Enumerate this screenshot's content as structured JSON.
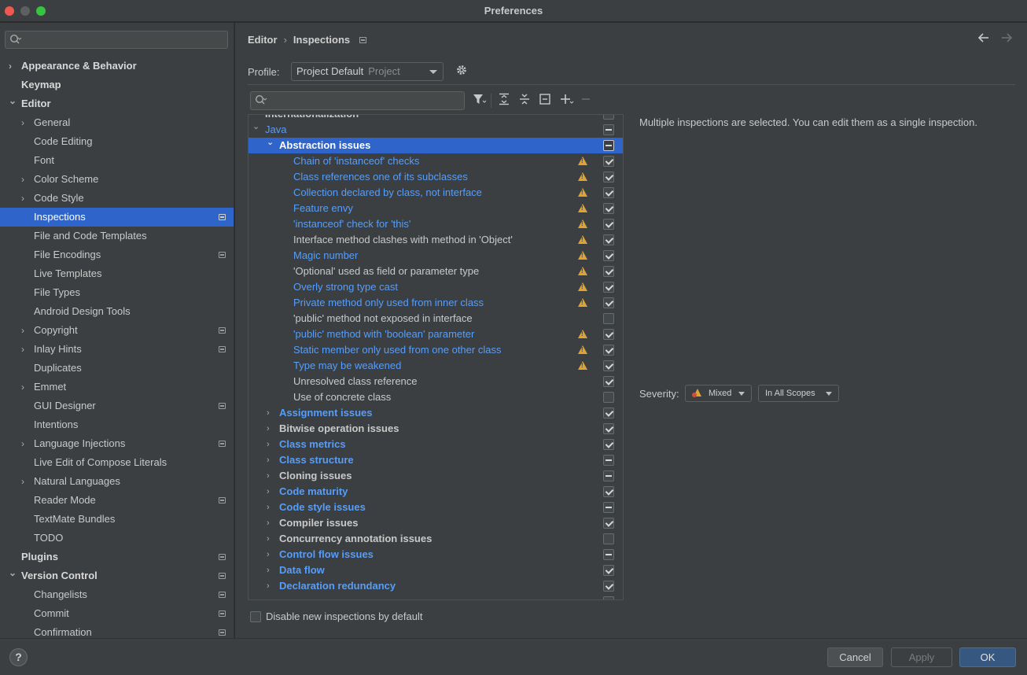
{
  "window": {
    "title": "Preferences"
  },
  "sidebar": {
    "search_placeholder": "",
    "items": [
      {
        "label": "Appearance & Behavior",
        "level": 0,
        "bold": true,
        "expandable": true,
        "expanded": false,
        "project": false,
        "selected": false
      },
      {
        "label": "Keymap",
        "level": 0,
        "bold": true,
        "expandable": false,
        "project": false,
        "selected": false
      },
      {
        "label": "Editor",
        "level": 0,
        "bold": true,
        "expandable": true,
        "expanded": true,
        "project": false,
        "selected": false
      },
      {
        "label": "General",
        "level": 1,
        "expandable": true,
        "expanded": false,
        "project": false,
        "selected": false
      },
      {
        "label": "Code Editing",
        "level": 1,
        "expandable": false,
        "project": false,
        "selected": false
      },
      {
        "label": "Font",
        "level": 1,
        "expandable": false,
        "project": false,
        "selected": false
      },
      {
        "label": "Color Scheme",
        "level": 1,
        "expandable": true,
        "expanded": false,
        "project": false,
        "selected": false
      },
      {
        "label": "Code Style",
        "level": 1,
        "expandable": true,
        "expanded": false,
        "project": false,
        "selected": false
      },
      {
        "label": "Inspections",
        "level": 1,
        "expandable": false,
        "project": true,
        "selected": true
      },
      {
        "label": "File and Code Templates",
        "level": 1,
        "expandable": false,
        "project": false,
        "selected": false
      },
      {
        "label": "File Encodings",
        "level": 1,
        "expandable": false,
        "project": true,
        "selected": false
      },
      {
        "label": "Live Templates",
        "level": 1,
        "expandable": false,
        "project": false,
        "selected": false
      },
      {
        "label": "File Types",
        "level": 1,
        "expandable": false,
        "project": false,
        "selected": false
      },
      {
        "label": "Android Design Tools",
        "level": 1,
        "expandable": false,
        "project": false,
        "selected": false
      },
      {
        "label": "Copyright",
        "level": 1,
        "expandable": true,
        "expanded": false,
        "project": true,
        "selected": false
      },
      {
        "label": "Inlay Hints",
        "level": 1,
        "expandable": true,
        "expanded": false,
        "project": true,
        "selected": false
      },
      {
        "label": "Duplicates",
        "level": 1,
        "expandable": false,
        "project": false,
        "selected": false
      },
      {
        "label": "Emmet",
        "level": 1,
        "expandable": true,
        "expanded": false,
        "project": false,
        "selected": false
      },
      {
        "label": "GUI Designer",
        "level": 1,
        "expandable": false,
        "project": true,
        "selected": false
      },
      {
        "label": "Intentions",
        "level": 1,
        "expandable": false,
        "project": false,
        "selected": false
      },
      {
        "label": "Language Injections",
        "level": 1,
        "expandable": true,
        "expanded": false,
        "project": true,
        "selected": false
      },
      {
        "label": "Live Edit of Compose Literals",
        "level": 1,
        "expandable": false,
        "project": false,
        "selected": false
      },
      {
        "label": "Natural Languages",
        "level": 1,
        "expandable": true,
        "expanded": false,
        "project": false,
        "selected": false
      },
      {
        "label": "Reader Mode",
        "level": 1,
        "expandable": false,
        "project": true,
        "selected": false
      },
      {
        "label": "TextMate Bundles",
        "level": 1,
        "expandable": false,
        "project": false,
        "selected": false
      },
      {
        "label": "TODO",
        "level": 1,
        "expandable": false,
        "project": false,
        "selected": false
      },
      {
        "label": "Plugins",
        "level": 0,
        "bold": true,
        "expandable": false,
        "project": true,
        "selected": false
      },
      {
        "label": "Version Control",
        "level": 0,
        "bold": true,
        "expandable": true,
        "expanded": true,
        "project": true,
        "selected": false
      },
      {
        "label": "Changelists",
        "level": 1,
        "expandable": false,
        "project": true,
        "selected": false
      },
      {
        "label": "Commit",
        "level": 1,
        "expandable": false,
        "project": true,
        "selected": false
      },
      {
        "label": "Confirmation",
        "level": 1,
        "expandable": false,
        "project": true,
        "selected": false
      }
    ]
  },
  "header": {
    "breadcrumb": [
      "Editor",
      "Inspections"
    ],
    "back_icon": "arrow-left-icon",
    "forward_icon": "arrow-right-icon"
  },
  "profile": {
    "label": "Profile:",
    "value": "Project Default",
    "sub": "Project",
    "settings_icon": "gear-icon"
  },
  "toolbar": {
    "search_placeholder": "",
    "icons": [
      "filter-icon",
      "expand-all-icon",
      "collapse-all-icon",
      "reset-icon",
      "add-icon",
      "remove-icon"
    ]
  },
  "inspection_tree": {
    "partial_top_label": "Internationalization",
    "rows": [
      {
        "label": "Java",
        "level": 0,
        "chevron": "down",
        "link": true,
        "bold": false,
        "warn": false,
        "check": "mixed",
        "selected": false
      },
      {
        "label": "Abstraction issues",
        "level": 1,
        "chevron": "down",
        "link": false,
        "bold": true,
        "warn": false,
        "check": "mixed",
        "selected": true
      },
      {
        "label": "Chain of 'instanceof' checks",
        "level": 2,
        "link": true,
        "warn": true,
        "check": "checked"
      },
      {
        "label": "Class references one of its subclasses",
        "level": 2,
        "link": true,
        "warn": true,
        "check": "checked"
      },
      {
        "label": "Collection declared by class, not interface",
        "level": 2,
        "link": true,
        "warn": true,
        "check": "checked"
      },
      {
        "label": "Feature envy",
        "level": 2,
        "link": true,
        "warn": true,
        "check": "checked"
      },
      {
        "label": "'instanceof' check for 'this'",
        "level": 2,
        "link": true,
        "warn": true,
        "check": "checked"
      },
      {
        "label": "Interface method clashes with method in 'Object'",
        "level": 2,
        "link": false,
        "warn": true,
        "check": "checked"
      },
      {
        "label": "Magic number",
        "level": 2,
        "link": true,
        "warn": true,
        "check": "checked"
      },
      {
        "label": "'Optional' used as field or parameter type",
        "level": 2,
        "link": false,
        "warn": true,
        "check": "checked"
      },
      {
        "label": "Overly strong type cast",
        "level": 2,
        "link": true,
        "warn": true,
        "check": "checked"
      },
      {
        "label": "Private method only used from inner class",
        "level": 2,
        "link": true,
        "warn": true,
        "check": "checked"
      },
      {
        "label": "'public' method not exposed in interface",
        "level": 2,
        "link": false,
        "warn": false,
        "check": "unchecked"
      },
      {
        "label": "'public' method with 'boolean' parameter",
        "level": 2,
        "link": true,
        "warn": true,
        "check": "checked"
      },
      {
        "label": "Static member only used from one other class",
        "level": 2,
        "link": true,
        "warn": true,
        "check": "checked"
      },
      {
        "label": "Type may be weakened",
        "level": 2,
        "link": true,
        "warn": true,
        "check": "checked"
      },
      {
        "label": "Unresolved class reference",
        "level": 2,
        "link": false,
        "warn": false,
        "check": "checked"
      },
      {
        "label": "Use of concrete class",
        "level": 2,
        "link": false,
        "warn": false,
        "check": "unchecked"
      },
      {
        "label": "Assignment issues",
        "level": 1,
        "chevron": "right",
        "link": true,
        "bold": true,
        "check": "checked"
      },
      {
        "label": "Bitwise operation issues",
        "level": 1,
        "chevron": "right",
        "link": false,
        "bold": true,
        "check": "checked"
      },
      {
        "label": "Class metrics",
        "level": 1,
        "chevron": "right",
        "link": true,
        "bold": true,
        "check": "checked"
      },
      {
        "label": "Class structure",
        "level": 1,
        "chevron": "right",
        "link": true,
        "bold": true,
        "check": "mixed"
      },
      {
        "label": "Cloning issues",
        "level": 1,
        "chevron": "right",
        "link": false,
        "bold": true,
        "check": "mixed"
      },
      {
        "label": "Code maturity",
        "level": 1,
        "chevron": "right",
        "link": true,
        "bold": true,
        "check": "checked"
      },
      {
        "label": "Code style issues",
        "level": 1,
        "chevron": "right",
        "link": true,
        "bold": true,
        "check": "mixed"
      },
      {
        "label": "Compiler issues",
        "level": 1,
        "chevron": "right",
        "link": false,
        "bold": true,
        "check": "checked"
      },
      {
        "label": "Concurrency annotation issues",
        "level": 1,
        "chevron": "right",
        "link": false,
        "bold": true,
        "check": "unchecked"
      },
      {
        "label": "Control flow issues",
        "level": 1,
        "chevron": "right",
        "link": true,
        "bold": true,
        "check": "mixed"
      },
      {
        "label": "Data flow",
        "level": 1,
        "chevron": "right",
        "link": true,
        "bold": true,
        "check": "checked"
      },
      {
        "label": "Declaration redundancy",
        "level": 1,
        "chevron": "right",
        "link": true,
        "bold": true,
        "check": "checked"
      }
    ]
  },
  "disable_new": {
    "label": "Disable new inspections by default",
    "checked": false
  },
  "details": {
    "description": "Multiple inspections are selected. You can edit them as a single inspection.",
    "severity_label": "Severity:",
    "severity_value": "Mixed",
    "scope_value": "In All Scopes"
  },
  "footer": {
    "help": "?",
    "cancel": "Cancel",
    "apply": "Apply",
    "ok": "OK"
  },
  "colors": {
    "accent": "#2f65ca",
    "link": "#589df6",
    "warning": "#e0a330",
    "ok_button": "#365880"
  }
}
